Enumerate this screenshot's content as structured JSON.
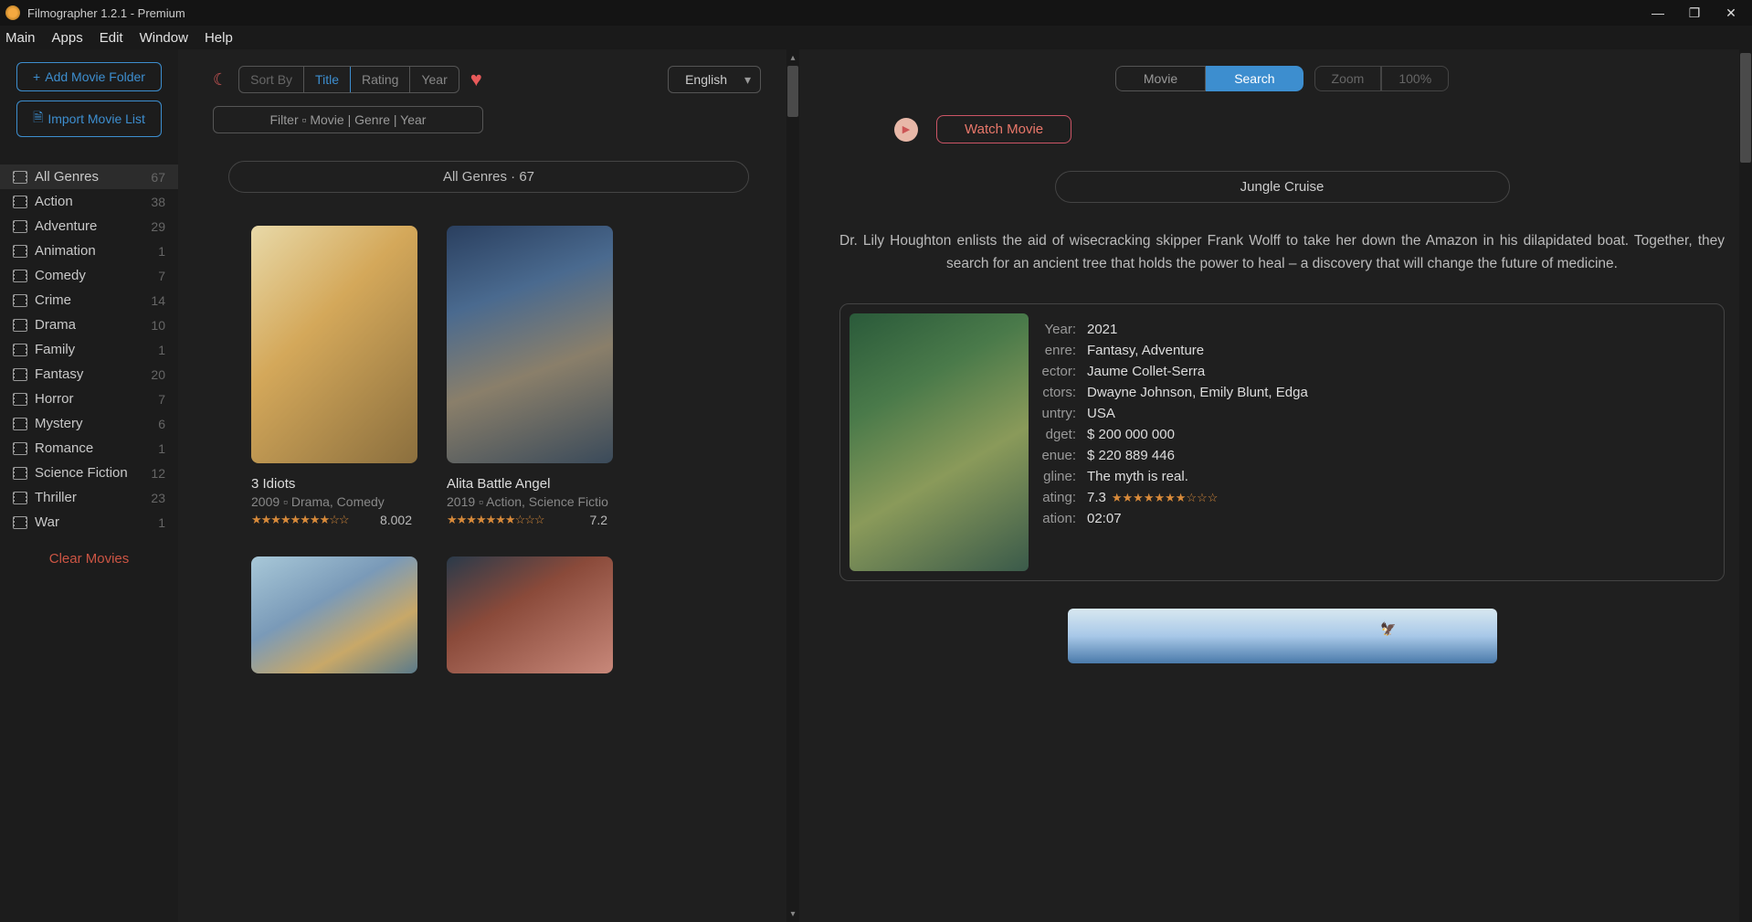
{
  "window": {
    "title": "Filmographer 1.2.1 - Premium"
  },
  "menu": [
    "Main",
    "Apps",
    "Edit",
    "Window",
    "Help"
  ],
  "sidebar": {
    "add_folder": "Add Movie Folder",
    "import_list": "Import Movie List",
    "clear": "Clear Movies",
    "genres": [
      {
        "name": "All Genres",
        "count": 67,
        "active": true
      },
      {
        "name": "Action",
        "count": 38
      },
      {
        "name": "Adventure",
        "count": 29
      },
      {
        "name": "Animation",
        "count": 1
      },
      {
        "name": "Comedy",
        "count": 7
      },
      {
        "name": "Crime",
        "count": 14
      },
      {
        "name": "Drama",
        "count": 10
      },
      {
        "name": "Family",
        "count": 1
      },
      {
        "name": "Fantasy",
        "count": 20
      },
      {
        "name": "Horror",
        "count": 7
      },
      {
        "name": "Mystery",
        "count": 6
      },
      {
        "name": "Romance",
        "count": 1
      },
      {
        "name": "Science Fiction",
        "count": 12
      },
      {
        "name": "Thriller",
        "count": 23
      },
      {
        "name": "War",
        "count": 1
      }
    ]
  },
  "center": {
    "sort_label": "Sort By",
    "sort_options": [
      "Title",
      "Rating",
      "Year"
    ],
    "sort_active": "Title",
    "language": "English",
    "filter_placeholder": "Filter ▫ Movie | Genre | Year",
    "heading": "All Genres · 67",
    "movies": [
      {
        "title": "3 Idiots",
        "meta": "2009 ▫ Drama, Comedy",
        "stars": "★★★★★★★★☆☆",
        "rating": "8.002"
      },
      {
        "title": "Alita Battle Angel",
        "meta": "2019 ▫ Action, Science Fictio",
        "stars": "★★★★★★★☆☆☆",
        "rating": "7.2"
      }
    ]
  },
  "right": {
    "tabs": [
      "Movie",
      "Search"
    ],
    "tab_active": "Search",
    "zoom_label": "Zoom",
    "zoom_value": "100%",
    "watch_label": "Watch Movie",
    "movie_title": "Jungle Cruise",
    "synopsis": "Dr. Lily Houghton enlists the aid of wisecracking skipper Frank Wolff to take her down the Amazon in his dilapidated boat. Together, they search for an ancient tree that holds the power to heal – a discovery that will change the future of medicine.",
    "details": [
      {
        "label": "Year:",
        "value": "2021"
      },
      {
        "label": "enre:",
        "value": "Fantasy, Adventure"
      },
      {
        "label": "ector:",
        "value": "Jaume Collet-Serra"
      },
      {
        "label": "ctors:",
        "value": "Dwayne Johnson, Emily Blunt, Edga"
      },
      {
        "label": "untry:",
        "value": "USA"
      },
      {
        "label": "dget:",
        "value": "$ 200 000 000"
      },
      {
        "label": "enue:",
        "value": "$ 220 889 446"
      },
      {
        "label": "gline:",
        "value": "The myth is real."
      },
      {
        "label": "ating:",
        "value": "7.3",
        "stars": "★★★★★★★☆☆☆"
      },
      {
        "label": "ation:",
        "value": "02:07"
      }
    ]
  }
}
